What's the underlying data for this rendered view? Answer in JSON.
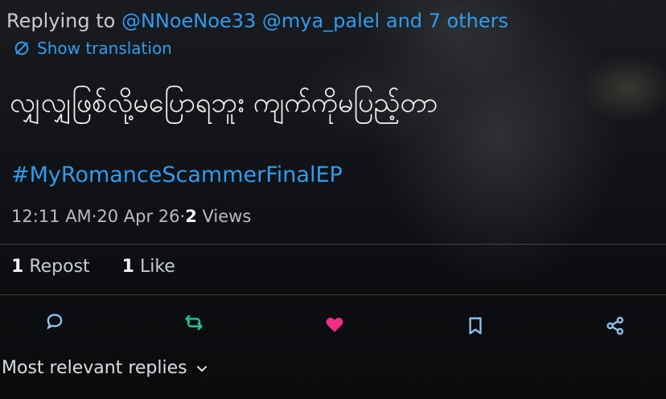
{
  "reply_context": {
    "prefix": "Replying to",
    "mention_1": "@NNoeNoe33",
    "mention_2": "@mya_palel",
    "suffix": "and 7 others"
  },
  "translation": {
    "label": "Show translation",
    "icon": "translate-icon"
  },
  "tweet": {
    "text": "လျှလျှဖြစ်လို့မပြောရဘူး ကျက်ကိုမပြည့်တာ",
    "hashtag": "#MyRomanceScammerFinalEP",
    "time": "12:11 AM",
    "date": "20 Apr 26",
    "views_count": "2",
    "views_label": "Views",
    "separator": " · "
  },
  "stats": {
    "reposts_count": "1",
    "reposts_label": "Repost",
    "likes_count": "1",
    "likes_label": "Like"
  },
  "actions": {
    "reply_icon": "reply-icon",
    "repost_icon": "repost-icon",
    "like_icon": "heart-icon",
    "bookmark_icon": "bookmark-icon",
    "share_icon": "share-icon",
    "repost_color": "#1fbf8f",
    "like_color": "#f02e86",
    "neutral_color": "#8fc3ef"
  },
  "replies": {
    "sort_label": "Most relevant replies"
  },
  "colors": {
    "link": "#2f9cf0",
    "background": "#0b0d10"
  }
}
